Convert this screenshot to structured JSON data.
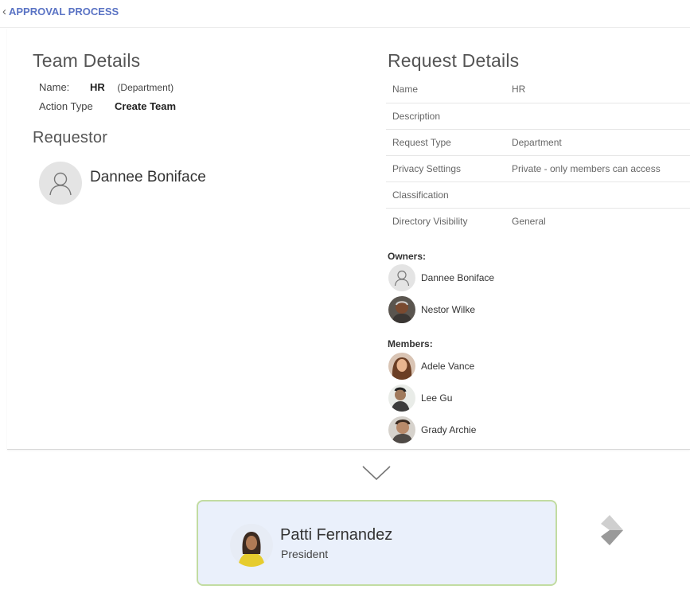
{
  "header": {
    "back_label": "APPROVAL PROCESS"
  },
  "team": {
    "title": "Team Details",
    "name_label": "Name:",
    "name_value": "HR",
    "name_sub": "(Department)",
    "action_label": "Action Type",
    "action_value": "Create Team"
  },
  "requestor": {
    "title": "Requestor",
    "name": "Dannee Boniface"
  },
  "request": {
    "title": "Request Details",
    "rows": [
      {
        "key": "Name",
        "value": "HR"
      },
      {
        "key": "Description",
        "value": ""
      },
      {
        "key": "Request Type",
        "value": "Department"
      },
      {
        "key": "Privacy Settings",
        "value": "Private - only members can access"
      },
      {
        "key": "Classification",
        "value": ""
      },
      {
        "key": "Directory Visibility",
        "value": "General"
      }
    ],
    "owners_label": "Owners:",
    "owners": [
      "Dannee Boniface",
      "Nestor Wilke"
    ],
    "members_label": "Members:",
    "members": [
      "Adele Vance",
      "Lee Gu",
      "Grady Archie"
    ]
  },
  "approver": {
    "name": "Patti Fernandez",
    "role": "President"
  },
  "icons": {
    "back": "chevron-left-icon",
    "down": "chevron-down-icon",
    "next": "diamond-arrow-icon",
    "placeholder": "person-placeholder-icon"
  }
}
